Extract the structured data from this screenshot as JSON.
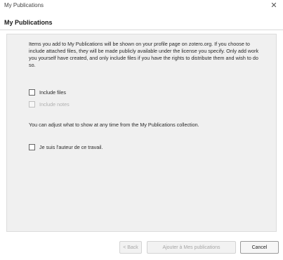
{
  "window": {
    "title": "My Publications"
  },
  "header": {
    "title": "My Publications"
  },
  "intro": {
    "text": "Items you add to My Publications will be shown on your profile page on zotero.org. If you choose to include attached files, they will be made publicly available under the license you specify. Only add work you yourself have created, and only include files if you have the rights to distribute them and wish to do so."
  },
  "options": {
    "include_files": {
      "label": "Include files",
      "checked": false
    },
    "include_notes": {
      "label": "Include notes",
      "checked": false,
      "disabled": true
    }
  },
  "adjust": {
    "text": "You can adjust what to show at any time from the My Publications collection."
  },
  "author_confirm": {
    "label": "Je suis l'auteur de ce travail.",
    "checked": false
  },
  "footer": {
    "back_label": "< Back",
    "next_label": "Ajouter à Mes publications",
    "cancel_label": "Cancel"
  }
}
